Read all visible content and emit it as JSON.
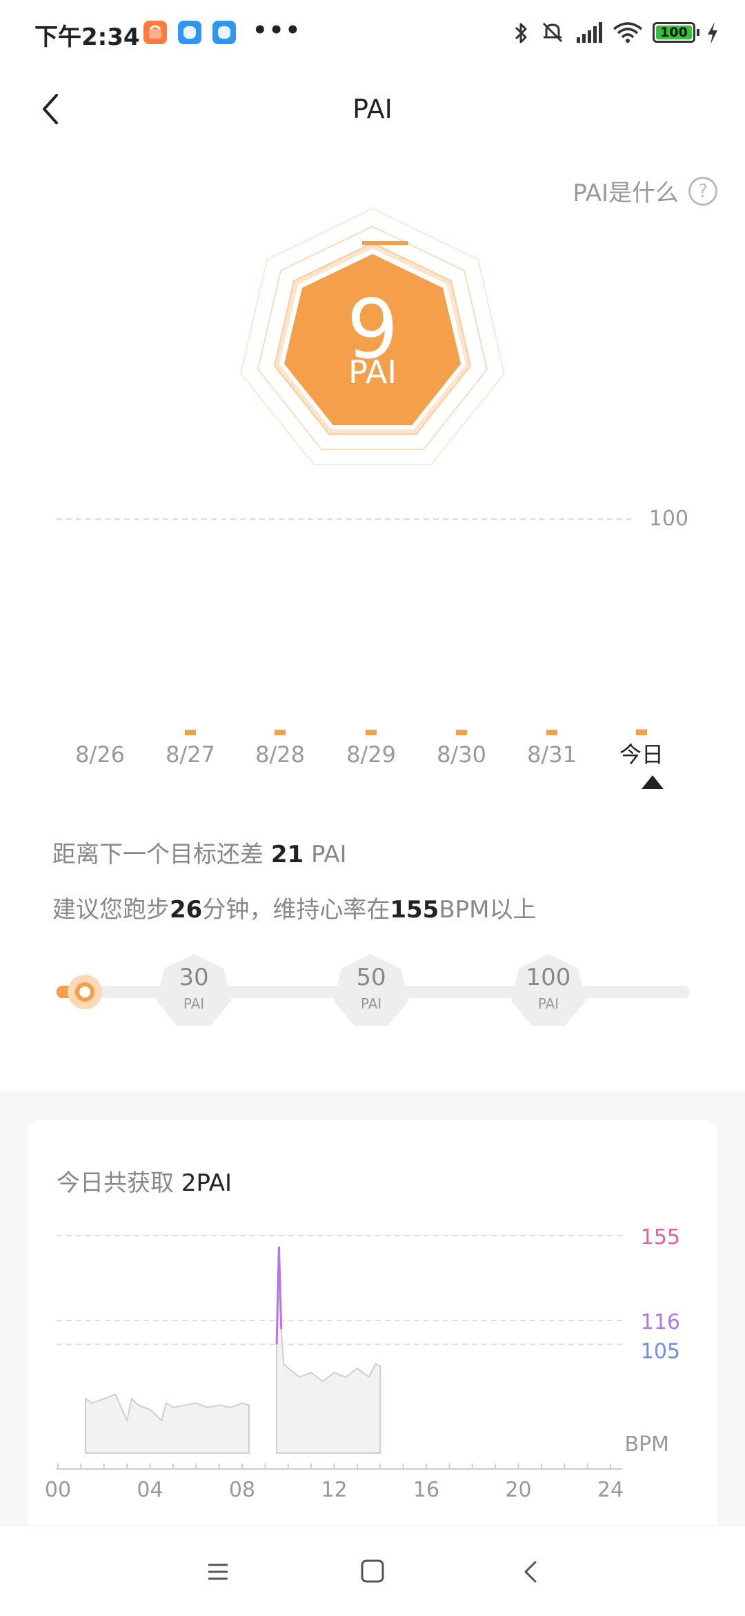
{
  "status_bar": {
    "time": "下午2:34",
    "dots": "•••",
    "battery": "100",
    "icons": [
      "bluetooth-icon",
      "mute-icon",
      "signal-icon",
      "wifi-icon",
      "battery-icon",
      "charging-icon"
    ],
    "app_icons": [
      "mi-store-icon",
      "mi-app-icon",
      "mi-app-icon-2"
    ]
  },
  "header": {
    "title": "PAI"
  },
  "info_link": {
    "label": "PAI是什么",
    "help": "?"
  },
  "hero": {
    "value": "9",
    "unit": "PAI",
    "progress": 0.09
  },
  "colors": {
    "accent": "#f4a04b",
    "accent_light": "#fbd8b6",
    "hr_pink": "#ec5c95",
    "hr_purple": "#b873e8",
    "hr_blue": "#6f8ef0"
  },
  "week_chart": {
    "reference": "100",
    "days": [
      "8/26",
      "8/27",
      "8/28",
      "8/29",
      "8/30",
      "8/31",
      "今日"
    ],
    "values": [
      0,
      2,
      5,
      5,
      5,
      7,
      9
    ],
    "selected_index": 6,
    "max": 100
  },
  "goal_info": {
    "line1_prefix": "距离下一个目标还差",
    "gap_value": "21",
    "gap_unit": "PAI",
    "line2_prefix": "建议您跑步",
    "minutes": "26",
    "minutes_unit": "分钟，维持心率在",
    "bpm": "155",
    "bpm_suffix": "BPM以上"
  },
  "goals": [
    {
      "value": "30",
      "unit": "PAI"
    },
    {
      "value": "50",
      "unit": "PAI"
    },
    {
      "value": "100",
      "unit": "PAI"
    }
  ],
  "today": {
    "label": "今日共获取",
    "value": "2PAI"
  },
  "chart_data": {
    "type": "area",
    "x_ticks": [
      "00",
      "04",
      "08",
      "12",
      "16",
      "20",
      "24"
    ],
    "xlim": [
      0,
      24
    ],
    "ylabel": "BPM",
    "thresholds": [
      {
        "label": "155",
        "value": 155,
        "color": "#ec5c95"
      },
      {
        "label": "116",
        "value": 116,
        "color": "#b873e8"
      },
      {
        "label": "105",
        "value": 105,
        "color": "#6f8ef0"
      }
    ],
    "segments": [
      {
        "x": [
          1.2,
          1.5,
          2.0,
          2.5,
          3.0,
          3.2,
          3.5,
          4.0,
          4.5,
          4.7,
          5.0,
          5.5,
          6.0,
          6.5,
          7.0,
          7.5,
          8.0,
          8.3
        ],
        "y": [
          80,
          78,
          80,
          82,
          70,
          80,
          77,
          75,
          70,
          78,
          76,
          77,
          78,
          76,
          77,
          76,
          78,
          77
        ]
      },
      {
        "x": [
          9.5,
          9.6,
          9.7,
          9.8,
          10.0,
          10.5,
          11.0,
          11.5,
          12.0,
          12.5,
          13.0,
          13.5,
          13.8,
          14.0
        ],
        "y": [
          105,
          150,
          112,
          96,
          94,
          90,
          92,
          88,
          92,
          90,
          94,
          90,
          96,
          95
        ]
      }
    ]
  },
  "nav_bar": {
    "buttons": [
      "menu-icon",
      "home-icon",
      "back-icon"
    ]
  }
}
